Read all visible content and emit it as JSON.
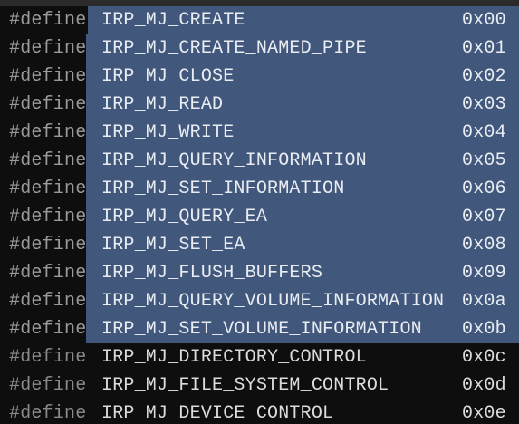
{
  "code_view": {
    "keyword": "#define",
    "lines": [
      {
        "name": "IRP_MJ_CREATE",
        "value": "0x00",
        "selected": true
      },
      {
        "name": "IRP_MJ_CREATE_NAMED_PIPE",
        "value": "0x01",
        "selected": true
      },
      {
        "name": "IRP_MJ_CLOSE",
        "value": "0x02",
        "selected": true
      },
      {
        "name": "IRP_MJ_READ",
        "value": "0x03",
        "selected": true
      },
      {
        "name": "IRP_MJ_WRITE",
        "value": "0x04",
        "selected": true
      },
      {
        "name": "IRP_MJ_QUERY_INFORMATION",
        "value": "0x05",
        "selected": true
      },
      {
        "name": "IRP_MJ_SET_INFORMATION",
        "value": "0x06",
        "selected": true
      },
      {
        "name": "IRP_MJ_QUERY_EA",
        "value": "0x07",
        "selected": true
      },
      {
        "name": "IRP_MJ_SET_EA",
        "value": "0x08",
        "selected": true
      },
      {
        "name": "IRP_MJ_FLUSH_BUFFERS",
        "value": "0x09",
        "selected": true
      },
      {
        "name": "IRP_MJ_QUERY_VOLUME_INFORMATION",
        "value": "0x0a",
        "selected": true
      },
      {
        "name": "IRP_MJ_SET_VOLUME_INFORMATION",
        "value": "0x0b",
        "selected": true
      },
      {
        "name": "IRP_MJ_DIRECTORY_CONTROL",
        "value": "0x0c",
        "selected": false
      },
      {
        "name": "IRP_MJ_FILE_SYSTEM_CONTROL",
        "value": "0x0d",
        "selected": false
      },
      {
        "name": "IRP_MJ_DEVICE_CONTROL",
        "value": "0x0e",
        "selected": false
      }
    ]
  },
  "colors": {
    "background": "#0e0e0e",
    "selection": "#41587c",
    "keyword": "#8a8a8a",
    "text": "#dcdcdc"
  }
}
